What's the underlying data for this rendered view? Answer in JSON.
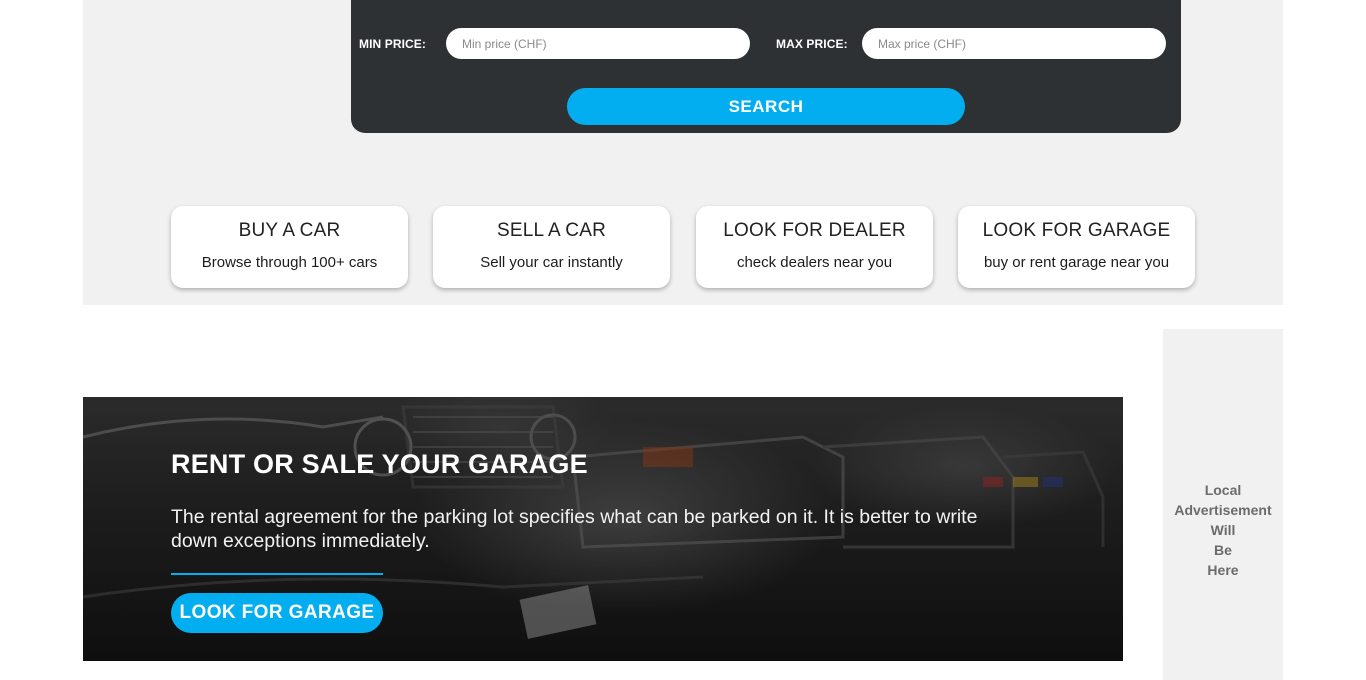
{
  "search": {
    "min_label": "MIN PRICE:",
    "min_placeholder": "Min price (CHF)",
    "max_label": "MAX PRICE:",
    "max_placeholder": "Max price (CHF)",
    "button_label": "SEARCH"
  },
  "cards": [
    {
      "title": "BUY A CAR",
      "subtitle": "Browse through 100+ cars"
    },
    {
      "title": "SELL A CAR",
      "subtitle": "Sell your car instantly"
    },
    {
      "title": "LOOK FOR DEALER",
      "subtitle": "check dealers near you"
    },
    {
      "title": "LOOK FOR GARAGE",
      "subtitle": "buy or rent garage near you"
    }
  ],
  "banner": {
    "title": "RENT OR SALE YOUR GARAGE",
    "text": "The rental agreement for the parking lot specifies what can be parked on it. It is better to write down exceptions immediately.",
    "button_label": "LOOK FOR GARAGE"
  },
  "ad": {
    "lines": [
      "Local",
      "Advertisement",
      "Will",
      "Be",
      "Here"
    ]
  },
  "colors": {
    "accent": "#02aeef",
    "panel": "#2e3133",
    "band": "#f1f1f1"
  }
}
